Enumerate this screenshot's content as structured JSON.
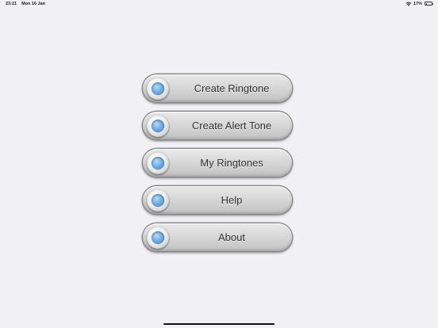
{
  "status_bar": {
    "time": "23:21",
    "date": "Mon 16 Jan",
    "battery_percent": "17%",
    "battery_level": 0.17
  },
  "menu": {
    "items": [
      {
        "label": "Create Ringtone"
      },
      {
        "label": "Create Alert Tone"
      },
      {
        "label": "My Ringtones"
      },
      {
        "label": "Help"
      },
      {
        "label": "About"
      }
    ]
  },
  "icons": {
    "wifi": "wifi-icon",
    "battery": "battery-icon",
    "menu_indicator": "blue-light-icon"
  },
  "colors": {
    "background": "#f1f0f5",
    "indicator_blue": "#6fb0e6"
  }
}
